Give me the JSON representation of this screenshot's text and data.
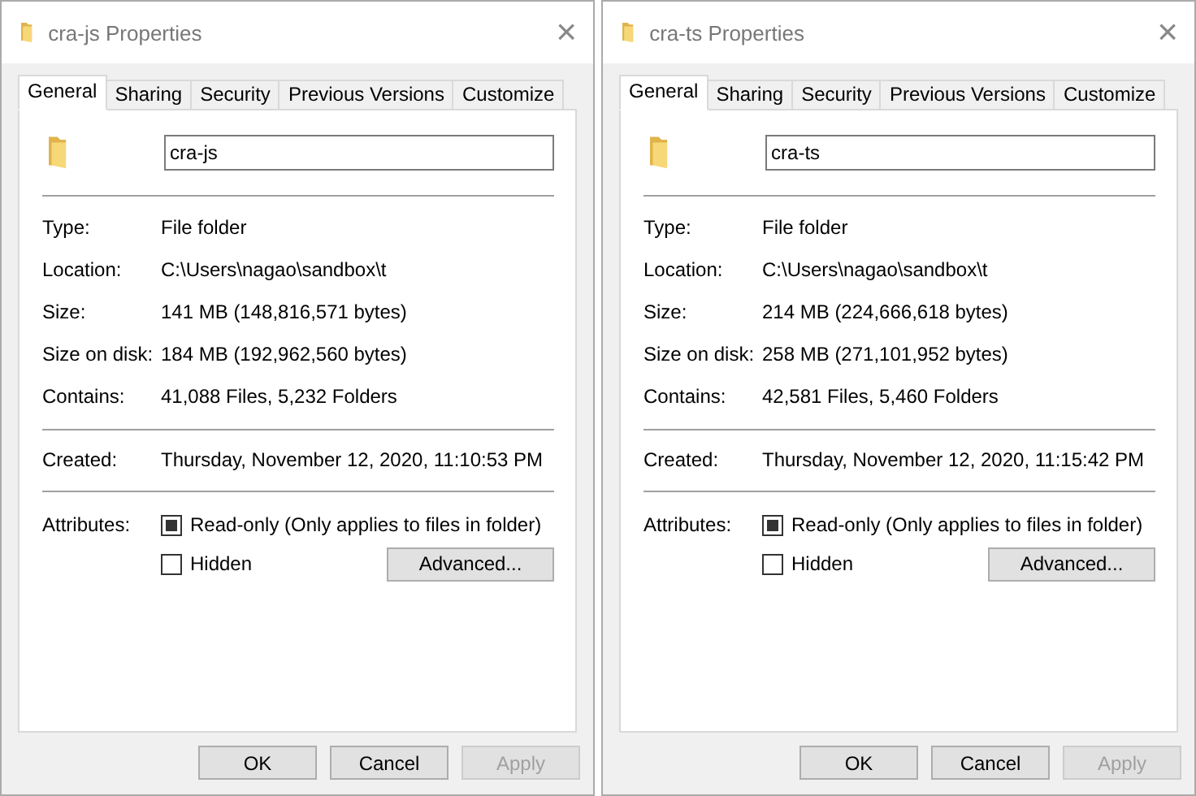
{
  "windows": [
    {
      "title": "cra-js Properties",
      "close": "×",
      "tabs": [
        {
          "label": "General",
          "selected": true
        },
        {
          "label": "Sharing",
          "selected": false
        },
        {
          "label": "Security",
          "selected": false
        },
        {
          "label": "Previous Versions",
          "selected": false
        },
        {
          "label": "Customize",
          "selected": false
        }
      ],
      "name": "cra-js",
      "groups": [
        [
          {
            "label": "Type:",
            "value": "File folder"
          },
          {
            "label": "Location:",
            "value": "C:\\Users\\nagao\\sandbox\\t"
          },
          {
            "label": "Size:",
            "value": "141 MB (148,816,571 bytes)"
          },
          {
            "label": "Size on disk:",
            "value": "184 MB (192,962,560 bytes)"
          },
          {
            "label": "Contains:",
            "value": "41,088 Files, 5,232 Folders"
          }
        ],
        [
          {
            "label": "Created:",
            "value": "Thursday, November 12, 2020, 11:10:53 PM"
          }
        ]
      ],
      "attributes": {
        "label": "Attributes:",
        "readonly": {
          "label": "Read-only (Only applies to files in folder)",
          "mixed": true
        },
        "hidden": {
          "label": "Hidden",
          "checked": false
        },
        "advanced": "Advanced..."
      },
      "buttons": [
        {
          "label": "OK",
          "disabled": false
        },
        {
          "label": "Cancel",
          "disabled": false
        },
        {
          "label": "Apply",
          "disabled": true
        }
      ]
    },
    {
      "title": "cra-ts Properties",
      "close": "×",
      "tabs": [
        {
          "label": "General",
          "selected": true
        },
        {
          "label": "Sharing",
          "selected": false
        },
        {
          "label": "Security",
          "selected": false
        },
        {
          "label": "Previous Versions",
          "selected": false
        },
        {
          "label": "Customize",
          "selected": false
        }
      ],
      "name": "cra-ts",
      "groups": [
        [
          {
            "label": "Type:",
            "value": "File folder"
          },
          {
            "label": "Location:",
            "value": "C:\\Users\\nagao\\sandbox\\t"
          },
          {
            "label": "Size:",
            "value": "214 MB (224,666,618 bytes)"
          },
          {
            "label": "Size on disk:",
            "value": "258 MB (271,101,952 bytes)"
          },
          {
            "label": "Contains:",
            "value": "42,581 Files, 5,460 Folders"
          }
        ],
        [
          {
            "label": "Created:",
            "value": "Thursday, November 12, 2020, 11:15:42 PM"
          }
        ]
      ],
      "attributes": {
        "label": "Attributes:",
        "readonly": {
          "label": "Read-only (Only applies to files in folder)",
          "mixed": true
        },
        "hidden": {
          "label": "Hidden",
          "checked": false
        },
        "advanced": "Advanced..."
      },
      "buttons": [
        {
          "label": "OK",
          "disabled": false
        },
        {
          "label": "Cancel",
          "disabled": false
        },
        {
          "label": "Apply",
          "disabled": true
        }
      ]
    }
  ]
}
